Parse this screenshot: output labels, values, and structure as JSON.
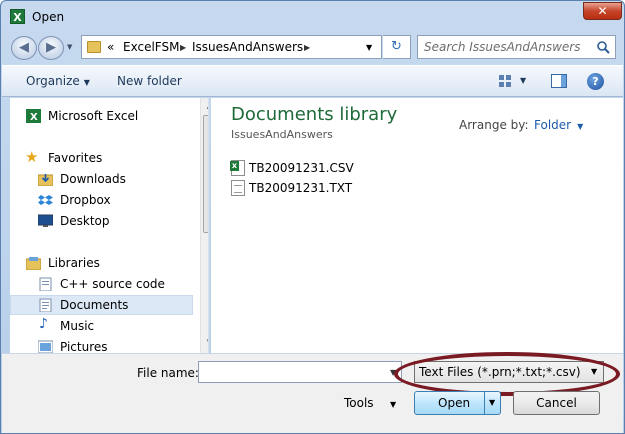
{
  "window": {
    "title": "Open",
    "close_glyph": "✕"
  },
  "address": {
    "back_glyph": "◀",
    "forward_glyph": "▶",
    "overflow": "«",
    "segments": [
      "ExcelFSM",
      "IssuesAndAnswers"
    ],
    "refresh_glyph": "↻"
  },
  "search": {
    "placeholder": "Search IssuesAndAnswers"
  },
  "toolbar": {
    "organize": "Organize",
    "new_folder": "New folder",
    "help_glyph": "?"
  },
  "nav": {
    "items": [
      {
        "label": "Microsoft Excel",
        "icon": "excel-icon"
      },
      {
        "label": "Favorites",
        "icon": "star-icon"
      },
      {
        "label": "Downloads",
        "icon": "downloads-folder-icon"
      },
      {
        "label": "Dropbox",
        "icon": "dropbox-icon"
      },
      {
        "label": "Desktop",
        "icon": "desktop-icon"
      },
      {
        "label": "Libraries",
        "icon": "libraries-icon"
      },
      {
        "label": "C++ source code",
        "icon": "library-folder-icon"
      },
      {
        "label": "Documents",
        "icon": "documents-icon",
        "selected": true
      },
      {
        "label": "Music",
        "icon": "music-icon"
      },
      {
        "label": "Pictures",
        "icon": "pictures-icon"
      }
    ]
  },
  "content": {
    "title": "Documents library",
    "subtitle": "IssuesAndAnswers",
    "arrange_label": "Arrange by:",
    "arrange_value": "Folder",
    "files": [
      {
        "name": "TB20091231.CSV",
        "icon": "csv-file-icon"
      },
      {
        "name": "TB20091231.TXT",
        "icon": "text-file-icon"
      }
    ]
  },
  "footer": {
    "file_name_label": "File name:",
    "file_name_value": "",
    "filter_value": "Text Files (*.prn;*.txt;*.csv)",
    "tools_label": "Tools",
    "open_label": "Open",
    "cancel_label": "Cancel"
  },
  "colors": {
    "library_title": "#1e6a39",
    "highlight_ellipse": "#7a1a22",
    "selected_row": "#dde8f6"
  }
}
